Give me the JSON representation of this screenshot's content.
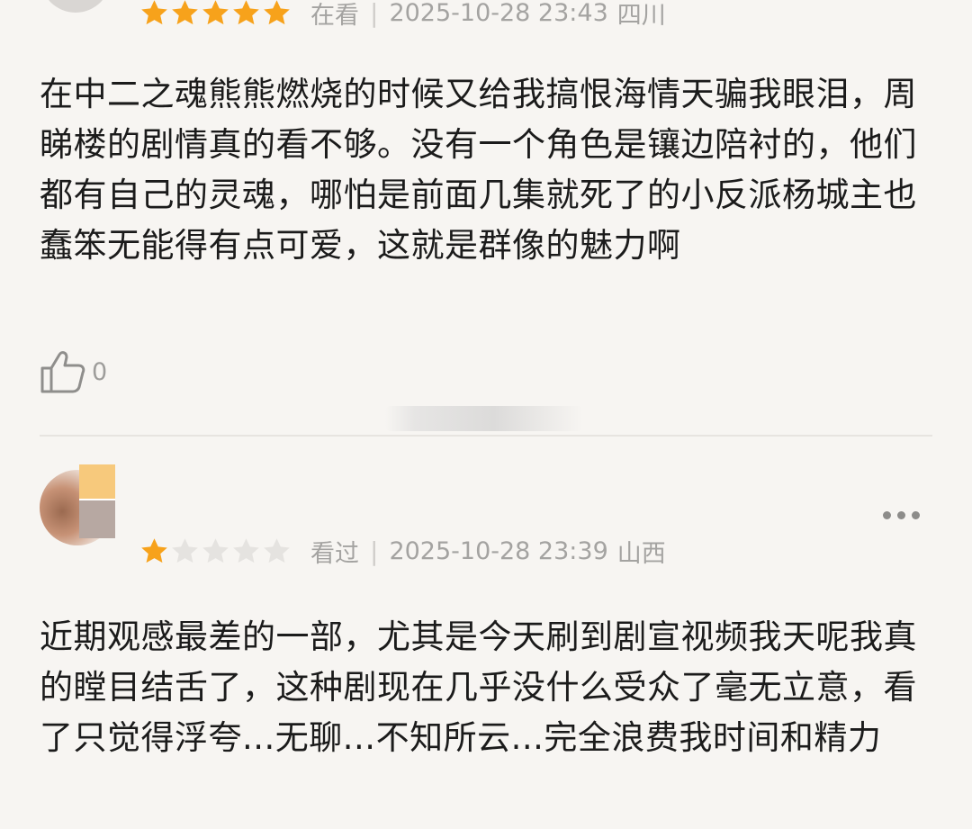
{
  "reviews": [
    {
      "rating": 5,
      "status": "在看",
      "datetime": "2025-10-28 23:43",
      "location": "四川",
      "text": "在中二之魂熊熊燃烧的时候又给我搞恨海情天骗我眼泪，周睇楼的剧情真的看不够。没有一个角色是镶边陪衬的，他们都有自己的灵魂，哪怕是前面几集就死了的小反派杨城主也蠢笨无能得有点可爱，这就是群像的魅力啊",
      "likes": "0"
    },
    {
      "rating": 1,
      "status": "看过",
      "datetime": "2025-10-28 23:39",
      "location": "山西",
      "text": "近期观感最差的一部，尤其是今天刷到剧宣视频我天呢我真的瞠目结舌了，这种剧现在几乎没什么受众了毫无立意，看了只觉得浮夸...无聊...不知所云...完全浪费我时间和精力"
    }
  ],
  "icons": {
    "like": "thumbs-up-icon",
    "more": "more-horizontal-icon",
    "star": "star-icon"
  },
  "colors": {
    "star_filled": "#f7a21b",
    "star_empty": "#e5e3e0",
    "meta_text": "#a4a3a1",
    "body_text": "#1b1b1b",
    "background": "#f7f5f2"
  }
}
